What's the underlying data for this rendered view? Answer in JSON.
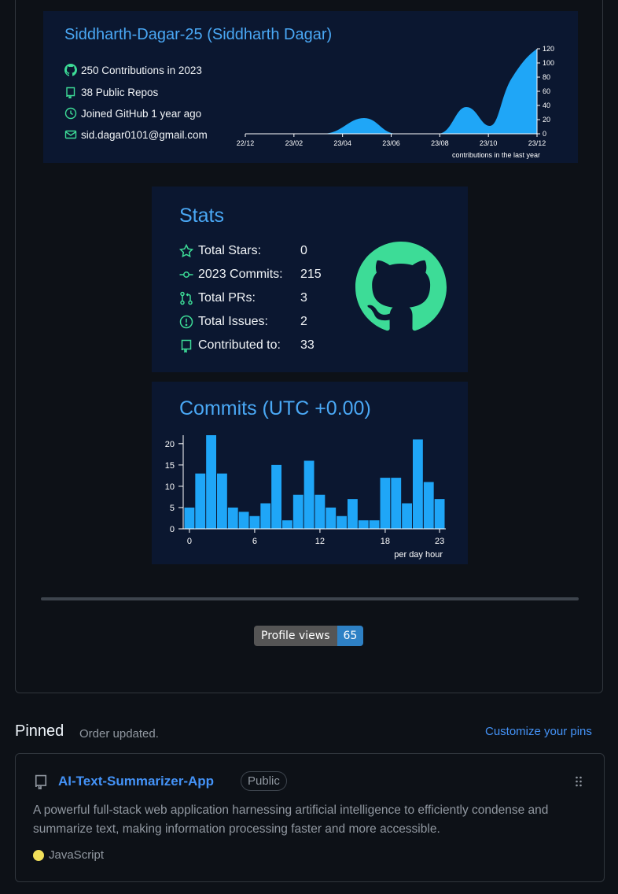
{
  "profile": {
    "title": "Siddharth-Dagar-25 (Siddharth Dagar)",
    "contributions": "250 Contributions in 2023",
    "repos": "38 Public Repos",
    "joined": "Joined GitHub 1 year ago",
    "email": "sid.dagar0101@gmail.com",
    "accent_color": "#4aa8f5",
    "icon_color": "#3ddc97"
  },
  "contrib_chart": {
    "type": "area",
    "x_ticks": [
      "22/12",
      "23/02",
      "23/04",
      "23/06",
      "23/08",
      "23/10",
      "23/12"
    ],
    "y_ticks": [
      "0",
      "20",
      "40",
      "60",
      "80",
      "100",
      "120"
    ],
    "ylim": [
      0,
      120
    ],
    "xlabel": "contributions in the last year",
    "fill": "#1fa6f7"
  },
  "stats": {
    "title": "Stats",
    "rows": [
      {
        "label": "Total Stars:",
        "value": "0",
        "icon": "star-icon"
      },
      {
        "label": "2023 Commits:",
        "value": "215",
        "icon": "commit-icon"
      },
      {
        "label": "Total PRs:",
        "value": "3",
        "icon": "pull-request-icon"
      },
      {
        "label": "Total Issues:",
        "value": "2",
        "icon": "issue-icon"
      },
      {
        "label": "Contributed to:",
        "value": "33",
        "icon": "repo-icon"
      }
    ]
  },
  "commits": {
    "title": "Commits (UTC +0.00)"
  },
  "chart_data": {
    "type": "bar",
    "categories": [
      0,
      1,
      2,
      3,
      4,
      5,
      6,
      7,
      8,
      9,
      10,
      11,
      12,
      13,
      14,
      15,
      16,
      17,
      18,
      19,
      20,
      21,
      22,
      23
    ],
    "values": [
      5,
      13,
      22,
      13,
      5,
      4,
      3,
      6,
      15,
      2,
      8,
      16,
      8,
      5,
      3,
      7,
      2,
      2,
      12,
      12,
      6,
      21,
      11,
      7
    ],
    "x_ticks": [
      "0",
      "6",
      "12",
      "18",
      "23"
    ],
    "y_ticks": [
      "0",
      "5",
      "10",
      "15",
      "20"
    ],
    "xlabel": "per day hour",
    "ylim": [
      0,
      22
    ],
    "color": "#1fa6f7"
  },
  "badge": {
    "label": "Profile views",
    "value": "65"
  },
  "pinned": {
    "title": "Pinned",
    "subtitle": "Order updated.",
    "customize": "Customize your pins",
    "repo": {
      "name": "AI-Text-Summarizer-App",
      "visibility": "Public",
      "description": "A powerful full-stack web application harnessing artificial intelligence to efficiently condense and summarize text, making information processing faster and more accessible.",
      "language": "JavaScript",
      "language_color": "#f1e05a"
    }
  }
}
